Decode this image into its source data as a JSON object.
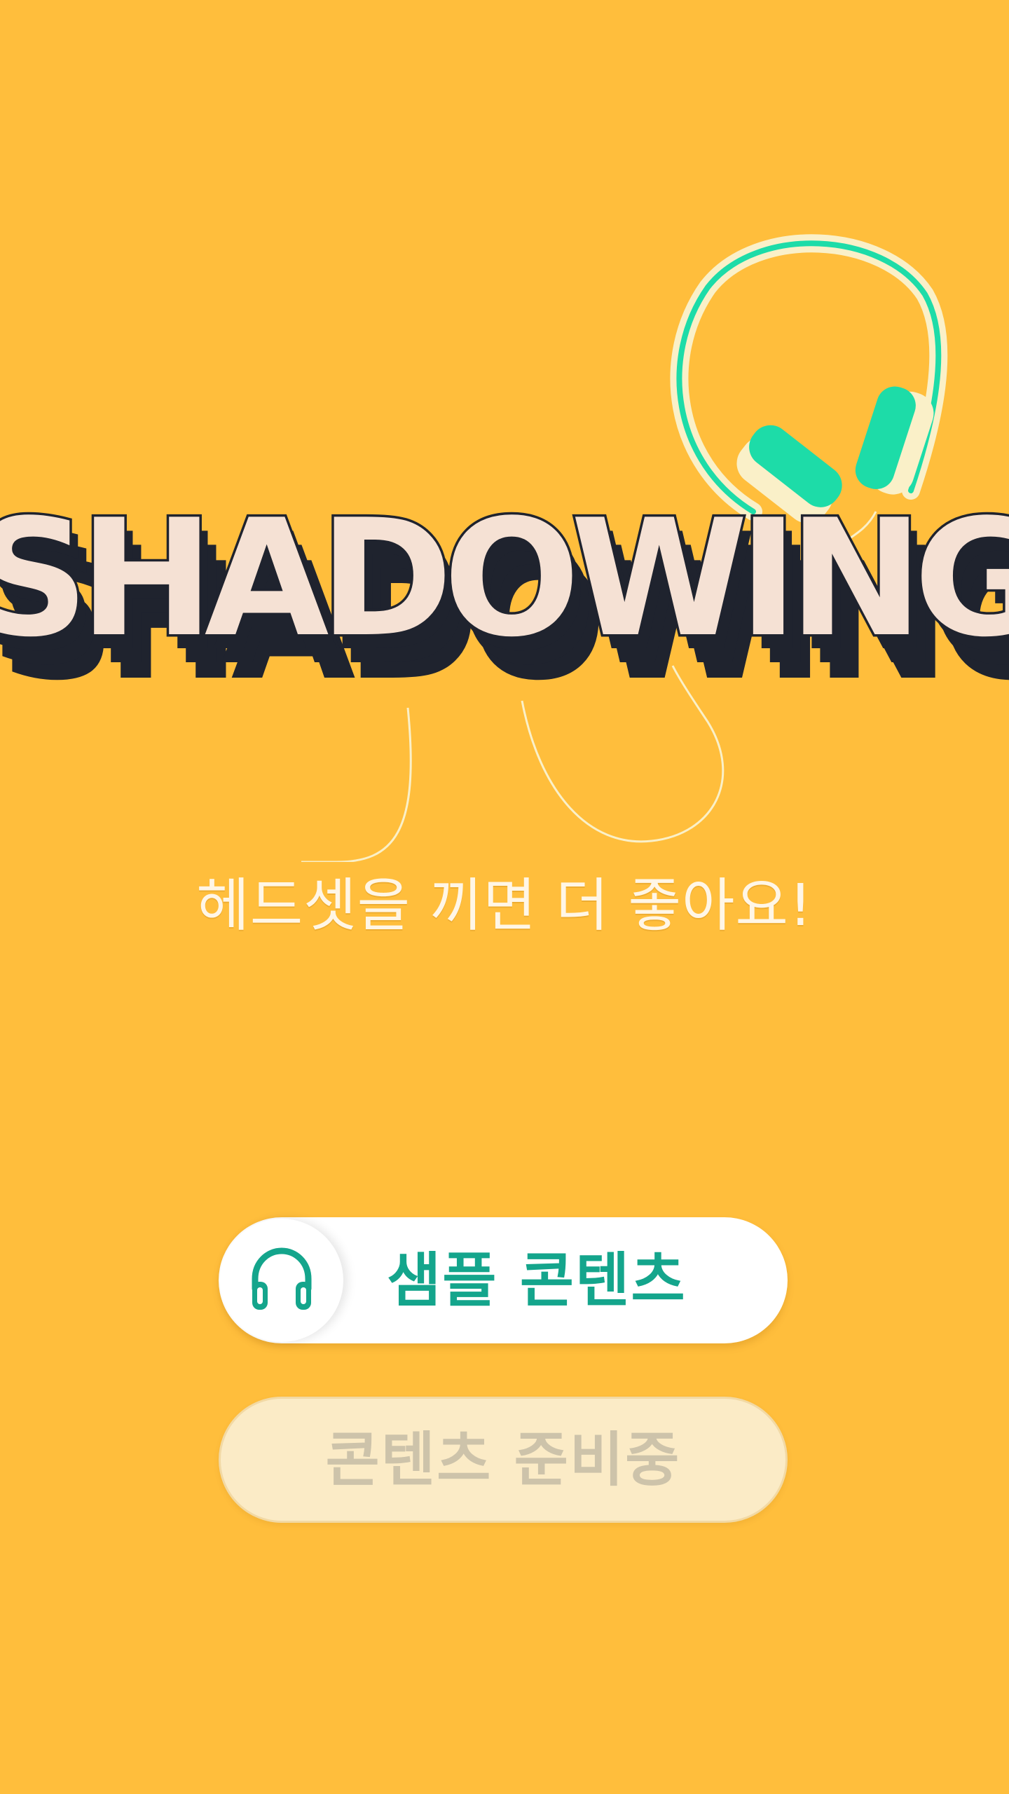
{
  "logo": {
    "text": "SHADOWING",
    "colors": {
      "letter_face": "#F5E1D4",
      "letter_outline": "#1F232E",
      "shadow": "#1F232E",
      "headphone_band": "#1DDCA8",
      "headphone_cushion": "#FAF0C8",
      "cable": "#FAF0C8"
    }
  },
  "subtitle": "헤드셋을 끼면 더 좋아요!",
  "buttons": {
    "sample": {
      "label": "샘플 콘텐츠",
      "icon": "headphones-icon"
    },
    "coming": {
      "label": "콘텐츠 준비중"
    }
  },
  "colors": {
    "background": "#FFBE3C",
    "accent": "#14A58C",
    "disabled_bg": "#FBEBC6",
    "disabled_text": "#CDC3AA"
  }
}
